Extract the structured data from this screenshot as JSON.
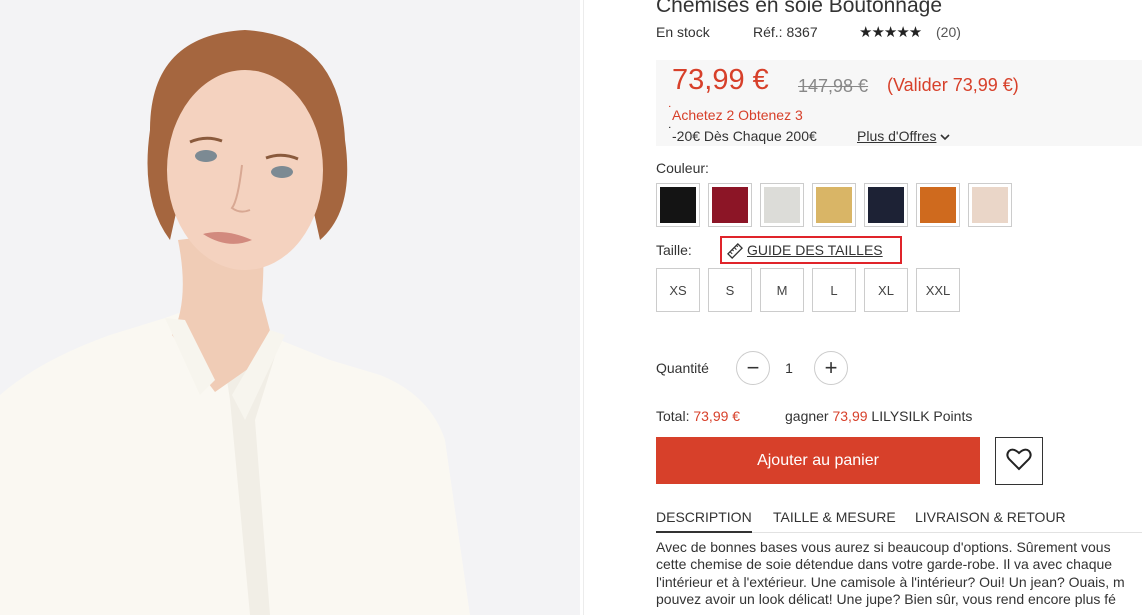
{
  "product": {
    "title": "Chemises en soie Boutonnage",
    "stock": "En stock",
    "ref": "Réf.: 8367",
    "stars": "★★★★★",
    "reviews": "(20)"
  },
  "pricing": {
    "price": "73,99 €",
    "old_price": "147,98 €",
    "valider": "(Valider 73,99 €)",
    "promo1": "Achetez 2 Obtenez 3",
    "promo2": "-20€ Dès Chaque 200€",
    "more_offers": "Plus d'Offres"
  },
  "color": {
    "label": "Couleur:",
    "swatches": [
      {
        "name": "black",
        "color": "#141414"
      },
      {
        "name": "claret",
        "color": "#8c1526"
      },
      {
        "name": "white",
        "color": "#dcdcd8"
      },
      {
        "name": "gold",
        "color": "#d9b566"
      },
      {
        "name": "navy",
        "color": "#1d2235"
      },
      {
        "name": "orange",
        "color": "#cf6a1e"
      },
      {
        "name": "nude",
        "color": "#ead6c8"
      }
    ]
  },
  "size": {
    "label": "Taille:",
    "guide": "GUIDE DES TAILLES",
    "options": [
      "XS",
      "S",
      "M",
      "L",
      "XL",
      "XXL"
    ]
  },
  "quantity": {
    "label": "Quantité",
    "value": "1",
    "minus": "−",
    "plus": "+"
  },
  "totals": {
    "total_label": "Total:",
    "total_value": "73,99 €",
    "gagner_label": "gagner",
    "points_value": "73,99",
    "points_label": "LILYSILK Points"
  },
  "actions": {
    "add_to_cart": "Ajouter au panier"
  },
  "tabs": [
    "DESCRIPTION",
    "TAILLE & MESURE",
    "LIVRAISON & RETOUR"
  ],
  "description": [
    "Avec de bonnes bases vous aurez si beaucoup d'options. Sûrement vous",
    "cette chemise de soie détendue dans votre garde-robe. Il va avec chaque",
    "l'intérieur et à l'extérieur. Une camisole à l'intérieur? Oui! Un jean? Ouais, m",
    "pouvez avoir un look délicat! Une jupe? Bien sûr, vous rend encore plus fé"
  ]
}
